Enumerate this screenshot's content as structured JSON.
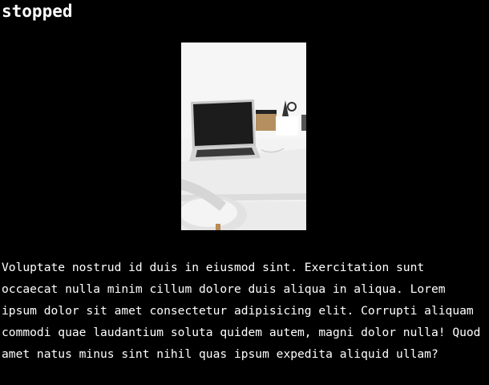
{
  "page": {
    "status_title": "stopped",
    "image": {
      "subject": "desk-with-laptop-photo"
    },
    "paragraph": "Voluptate nostrud id duis in eiusmod sint. Exercitation sunt occaecat nulla minim cillum dolore duis aliqua in aliqua. Lorem ipsum dolor sit amet consectetur adipisicing elit. Corrupti aliquam commodi quae laudantium soluta quidem autem, magni dolor nulla! Quod amet natus minus sint nihil quas ipsum expedita aliquid ullam?"
  },
  "colors": {
    "background": "#000000",
    "text": "#ffffff"
  }
}
